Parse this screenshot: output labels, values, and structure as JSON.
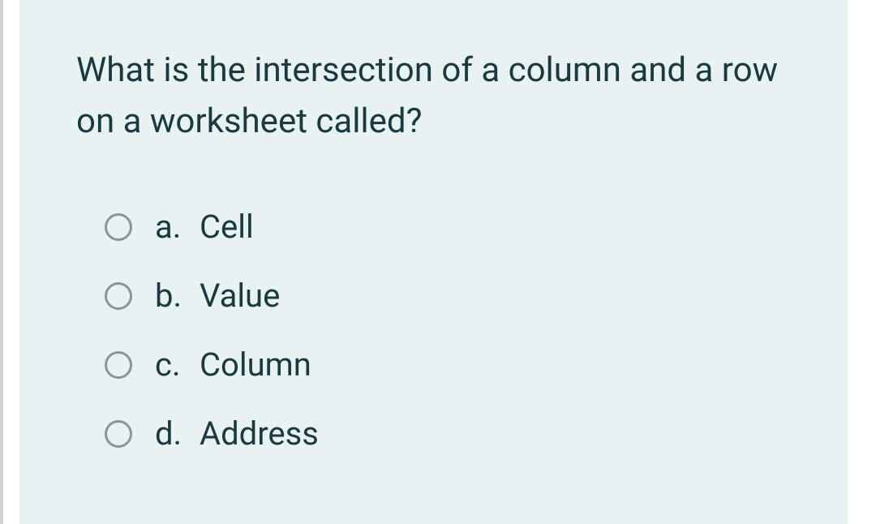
{
  "question": {
    "text": "What is the intersection of a column and a row on a worksheet called?"
  },
  "options": [
    {
      "letter": "a.",
      "text": "Cell"
    },
    {
      "letter": "b.",
      "text": "Value"
    },
    {
      "letter": "c.",
      "text": "Column"
    },
    {
      "letter": "d.",
      "text": "Address"
    }
  ]
}
